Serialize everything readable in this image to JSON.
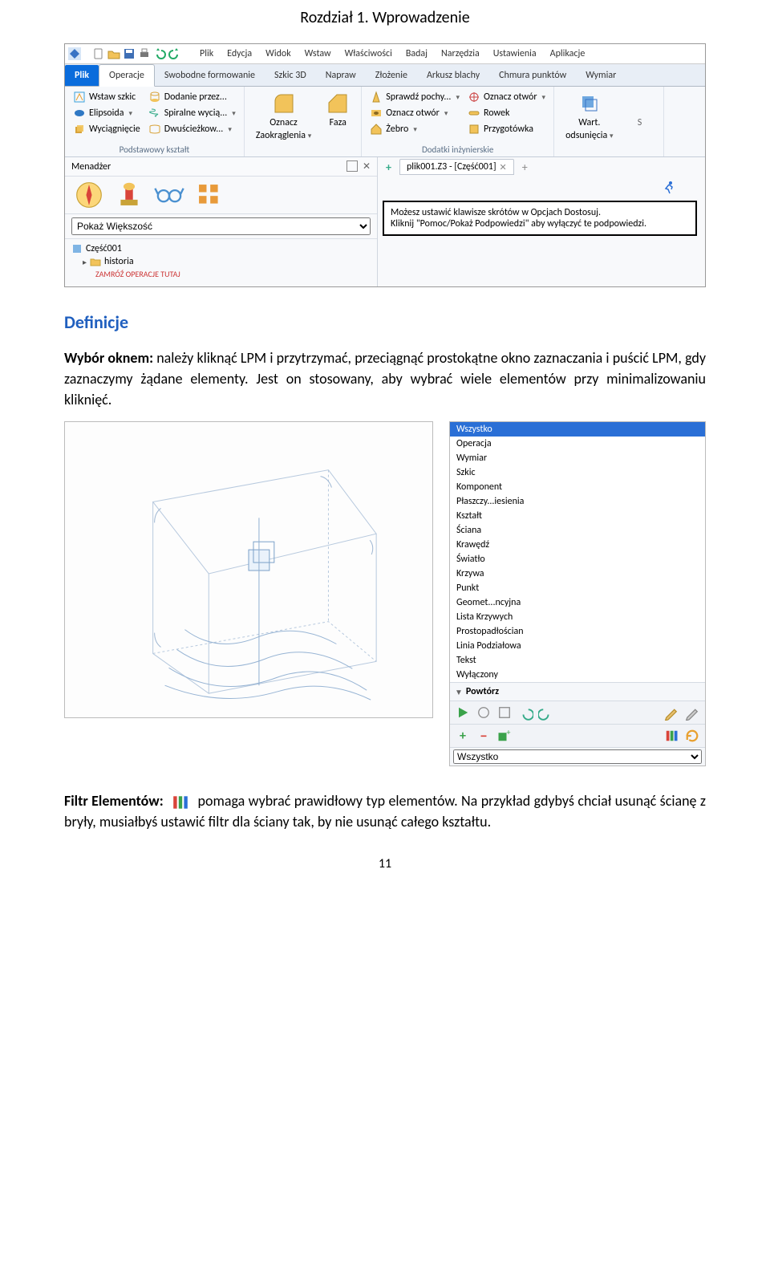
{
  "chapter_title": "Rozdział 1. Wprowadzenie",
  "menubar": {
    "items": [
      "Plik",
      "Edycja",
      "Widok",
      "Wstaw",
      "Właściwości",
      "Badaj",
      "Narzędzia",
      "Ustawienia",
      "Aplikacje"
    ]
  },
  "tabs": {
    "file": "Plik",
    "selected": "Operacje",
    "rest": [
      "Swobodne formowanie",
      "Szkic 3D",
      "Napraw",
      "Złożenie",
      "Arkusz blachy",
      "Chmura punktów",
      "Wymiar"
    ]
  },
  "ribbon": {
    "group1_label": "Podstawowy kształt",
    "g1": {
      "r1": "Wstaw szkic",
      "r2": "Elipsoida",
      "r3": "Wyciągnięcie",
      "r4": "Dodanie przez...",
      "r5": "Spiralne wycią...",
      "r6": "Dwuścieżkow..."
    },
    "group2_label": "",
    "g2": {
      "a": "Oznacz",
      "b": "Zaokrąglenia",
      "c": "Faza"
    },
    "group3_label": "Dodatki inżynierskie",
    "g3": {
      "a": "Sprawdź pochy...",
      "b": "Oznacz otwór",
      "c": "Żebro",
      "d": "Oznacz otwór",
      "e": "Rowek",
      "f": "Przygotówka"
    },
    "group4_label": "",
    "g4": {
      "a": "Wart.",
      "b": "odsunięcia",
      "c": "S"
    }
  },
  "mgr_bar_label": "Menadżer",
  "doc_tab": "plik001.Z3 - [Część001]",
  "mgr_dropdown": "Pokaż Większość",
  "tree": {
    "root": "Część001",
    "hist": "historia",
    "frozen": "ZAMRÓŹ OPERACJE TUTAJ"
  },
  "tooltip": {
    "line1": "Możesz ustawić klawisze skrótów w Opcjach Dostosuj.",
    "line2": "Kliknij \"Pomoc/Pokaż Podpowiedzi\" aby wyłączyć te podpowiedzi."
  },
  "definitions_title": "Definicje",
  "para1_lead": "Wybór oknem:",
  "para1_rest": " należy kliknąć LPM i przytrzymać, przeciągnąć prostokątne okno zaznaczania i puścić LPM, gdy zaznaczymy żądane elementy. Jest on stosowany, aby wybrać wiele elementów przy minimalizowaniu kliknięć.",
  "filter_panel": {
    "items": [
      "Wszystko",
      "Operacja",
      "Wymiar",
      "Szkic",
      "Komponent",
      "Płaszczy...iesienia",
      "Kształt",
      "Ściana",
      "Krawędź",
      "Światło",
      "Krzywa",
      "Punkt",
      "Geomet...ncyjna",
      "Lista Krzywych",
      "Prostopadłościan",
      "Linia Podziałowa",
      "Tekst",
      "Wyłączony"
    ],
    "powtorz": "Powtórz",
    "selector_value": "Wszystko"
  },
  "para2_lead": "Filtr Elementów:",
  "para2_mid": " pomaga wybrać prawidłowy typ elementów. Na przykład gdybyś chciał usunąć ścianę z bryły, musiałbyś ustawić filtr dla ściany tak, by nie usunąć całego kształtu.",
  "page_number": "11"
}
